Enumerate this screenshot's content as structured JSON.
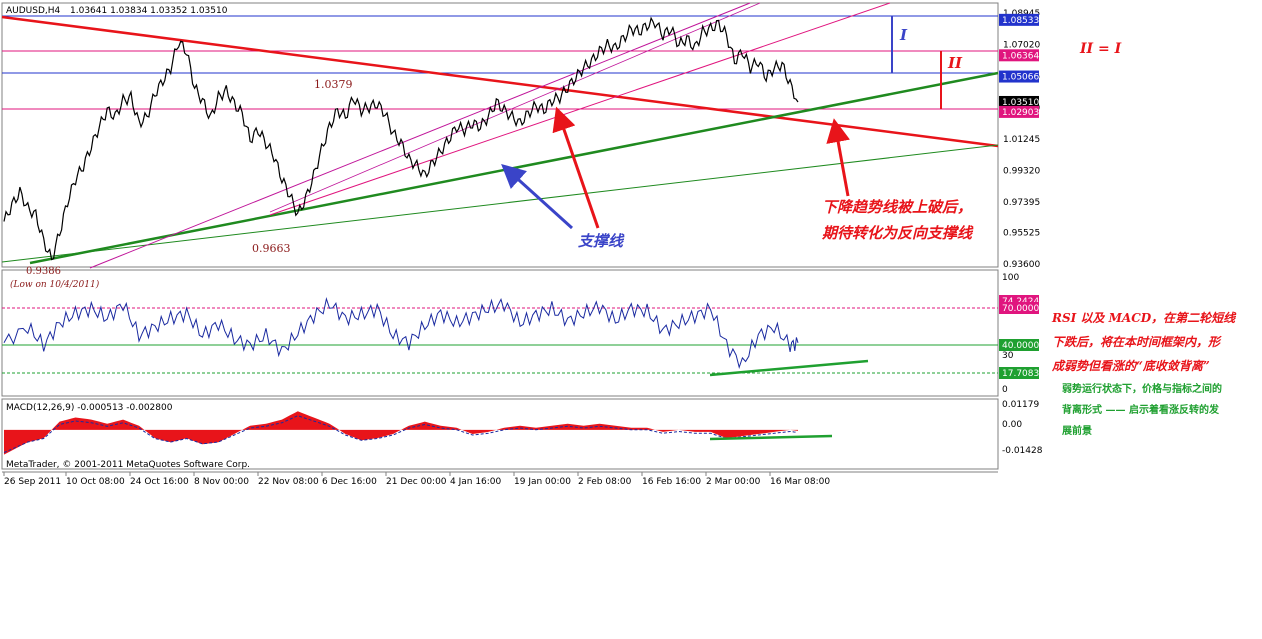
{
  "chart_data": {
    "type": "line",
    "title": "AUDUSD,H4",
    "ohlc": "1.03641 1.03834 1.03352 1.03510",
    "x_ticks": [
      "26 Sep 2011",
      "10 Oct 08:00",
      "24 Oct 16:00",
      "8 Nov 00:00",
      "22 Nov 08:00",
      "6 Dec 16:00",
      "21 Dec 00:00",
      "4 Jan 16:00",
      "19 Jan 00:00",
      "2 Feb 08:00",
      "16 Feb 16:00",
      "2 Mar 00:00",
      "16 Mar 08:00"
    ],
    "price_ticks": [
      "1.08945",
      "1.07020",
      "1.05095",
      "1.03170",
      "1.01245",
      "0.99320",
      "0.97395",
      "0.95525",
      "0.93600"
    ],
    "price_ylim": [
      0.936,
      1.0938
    ],
    "price_badges": [
      {
        "value": "1.08533",
        "color": "#2233cc"
      },
      {
        "value": "1.06364",
        "color": "#e0157e"
      },
      {
        "value": "1.05066",
        "color": "#2233cc"
      },
      {
        "value": "1.03510",
        "color": "#000000"
      },
      {
        "value": "1.02903",
        "color": "#e0157e"
      }
    ],
    "price_series": [
      [
        0,
        0.962
      ],
      [
        2,
        0.972
      ],
      [
        4,
        0.98
      ],
      [
        6,
        0.97
      ],
      [
        8,
        0.966
      ],
      [
        10,
        0.95
      ],
      [
        12,
        0.9386
      ],
      [
        14,
        0.955
      ],
      [
        16,
        0.974
      ],
      [
        18,
        0.988
      ],
      [
        20,
        0.996
      ],
      [
        22,
        1.008
      ],
      [
        24,
        1.02
      ],
      [
        26,
        1.03
      ],
      [
        28,
        1.026
      ],
      [
        30,
        1.036
      ],
      [
        32,
        1.038
      ],
      [
        34,
        1.022
      ],
      [
        36,
        1.026
      ],
      [
        38,
        1.04
      ],
      [
        40,
        1.048
      ],
      [
        42,
        1.056
      ],
      [
        44,
        1.072
      ],
      [
        46,
        1.066
      ],
      [
        48,
        1.044
      ],
      [
        50,
        1.036
      ],
      [
        52,
        1.025
      ],
      [
        54,
        1.038
      ],
      [
        56,
        1.042
      ],
      [
        58,
        1.034
      ],
      [
        60,
        1.028
      ],
      [
        62,
        1.012
      ],
      [
        64,
        1.018
      ],
      [
        66,
        1.01
      ],
      [
        68,
        1.002
      ],
      [
        70,
        0.988
      ],
      [
        72,
        0.978
      ],
      [
        74,
        0.9663
      ],
      [
        76,
        0.976
      ],
      [
        78,
        0.99
      ],
      [
        80,
        1.006
      ],
      [
        82,
        1.02
      ],
      [
        84,
        1.03
      ],
      [
        86,
        1.026
      ],
      [
        88,
        1.0379
      ],
      [
        90,
        1.03
      ],
      [
        92,
        1.032
      ],
      [
        94,
        1.034
      ],
      [
        96,
        1.028
      ],
      [
        98,
        1.016
      ],
      [
        100,
        1.01
      ],
      [
        102,
        1.0
      ],
      [
        104,
        0.996
      ],
      [
        106,
        0.99
      ],
      [
        108,
        0.998
      ],
      [
        110,
        1.005
      ],
      [
        112,
        1.012
      ],
      [
        114,
        1.02
      ],
      [
        116,
        1.018
      ],
      [
        118,
        1.022
      ],
      [
        120,
        1.02
      ],
      [
        122,
        1.026
      ],
      [
        124,
        1.035
      ],
      [
        126,
        1.03
      ],
      [
        128,
        1.026
      ],
      [
        130,
        1.022
      ],
      [
        132,
        1.028
      ],
      [
        134,
        1.033
      ],
      [
        136,
        1.03
      ],
      [
        138,
        1.036
      ],
      [
        140,
        1.038
      ],
      [
        142,
        1.044
      ],
      [
        144,
        1.05
      ],
      [
        146,
        1.056
      ],
      [
        148,
        1.06
      ],
      [
        150,
        1.066
      ],
      [
        152,
        1.07
      ],
      [
        154,
        1.068
      ],
      [
        156,
        1.074
      ],
      [
        158,
        1.08
      ],
      [
        160,
        1.078
      ],
      [
        162,
        1.082
      ],
      [
        164,
        1.084
      ],
      [
        166,
        1.076
      ],
      [
        168,
        1.08
      ],
      [
        170,
        1.07
      ],
      [
        172,
        1.074
      ],
      [
        174,
        1.068
      ],
      [
        176,
        1.078
      ],
      [
        178,
        1.08
      ],
      [
        180,
        1.083
      ],
      [
        182,
        1.076
      ],
      [
        184,
        1.06
      ],
      [
        186,
        1.066
      ],
      [
        188,
        1.056
      ],
      [
        190,
        1.06
      ],
      [
        192,
        1.05
      ],
      [
        194,
        1.056
      ],
      [
        196,
        1.058
      ],
      [
        198,
        1.046
      ],
      [
        200,
        1.0351
      ]
    ],
    "rsi_label_ticks": [
      "100",
      "30",
      "0"
    ],
    "rsi_badges": [
      {
        "value": "74.2424",
        "color": "#e0157e"
      },
      {
        "value": "70.0000",
        "color": "#e0157e"
      },
      {
        "value": "40.0000",
        "color": "#1fa030"
      },
      {
        "value": "17.7083",
        "color": "#1fa030"
      }
    ],
    "rsi_ylim": [
      0,
      100
    ],
    "rsi_series": [
      [
        0,
        42
      ],
      [
        6,
        55
      ],
      [
        10,
        40
      ],
      [
        14,
        58
      ],
      [
        18,
        66
      ],
      [
        22,
        70
      ],
      [
        26,
        62
      ],
      [
        30,
        74
      ],
      [
        34,
        48
      ],
      [
        38,
        55
      ],
      [
        42,
        62
      ],
      [
        46,
        66
      ],
      [
        50,
        48
      ],
      [
        54,
        58
      ],
      [
        58,
        45
      ],
      [
        62,
        40
      ],
      [
        66,
        48
      ],
      [
        70,
        35
      ],
      [
        74,
        50
      ],
      [
        78,
        64
      ],
      [
        82,
        74
      ],
      [
        86,
        62
      ],
      [
        90,
        65
      ],
      [
        94,
        70
      ],
      [
        98,
        48
      ],
      [
        102,
        42
      ],
      [
        106,
        56
      ],
      [
        110,
        66
      ],
      [
        114,
        58
      ],
      [
        118,
        64
      ],
      [
        122,
        70
      ],
      [
        126,
        74
      ],
      [
        130,
        58
      ],
      [
        134,
        65
      ],
      [
        138,
        70
      ],
      [
        142,
        60
      ],
      [
        146,
        66
      ],
      [
        150,
        72
      ],
      [
        154,
        60
      ],
      [
        158,
        70
      ],
      [
        162,
        68
      ],
      [
        166,
        52
      ],
      [
        170,
        58
      ],
      [
        174,
        64
      ],
      [
        178,
        70
      ],
      [
        182,
        40
      ],
      [
        186,
        24
      ],
      [
        190,
        48
      ],
      [
        194,
        55
      ],
      [
        198,
        40
      ],
      [
        200,
        42
      ]
    ],
    "macd_label": "MACD(12,26,9) -0.000513 -0.002800",
    "macd_ticks": [
      "0.01179",
      "0.00",
      "-0.01428"
    ],
    "macd_ylim": [
      -0.018,
      0.014
    ],
    "macd_series": [
      [
        0,
        -0.012
      ],
      [
        6,
        -0.006
      ],
      [
        10,
        -0.004
      ],
      [
        14,
        0.004
      ],
      [
        18,
        0.006
      ],
      [
        22,
        0.005
      ],
      [
        26,
        0.003
      ],
      [
        30,
        0.005
      ],
      [
        34,
        0.002
      ],
      [
        38,
        -0.004
      ],
      [
        42,
        -0.006
      ],
      [
        46,
        -0.004
      ],
      [
        50,
        -0.007
      ],
      [
        54,
        -0.006
      ],
      [
        58,
        -0.002
      ],
      [
        62,
        0.002
      ],
      [
        66,
        0.003
      ],
      [
        70,
        0.005
      ],
      [
        74,
        0.009
      ],
      [
        78,
        0.006
      ],
      [
        82,
        0.003
      ],
      [
        86,
        -0.002
      ],
      [
        90,
        -0.005
      ],
      [
        94,
        -0.004
      ],
      [
        98,
        -0.002
      ],
      [
        102,
        0.002
      ],
      [
        106,
        0.004
      ],
      [
        110,
        0.002
      ],
      [
        114,
        0.001
      ],
      [
        118,
        -0.002
      ],
      [
        122,
        -0.001
      ],
      [
        126,
        0.001
      ],
      [
        130,
        0.002
      ],
      [
        134,
        0.001
      ],
      [
        138,
        0.002
      ],
      [
        142,
        0.003
      ],
      [
        146,
        0.002
      ],
      [
        150,
        0.003
      ],
      [
        154,
        0.002
      ],
      [
        158,
        0.001
      ],
      [
        162,
        0.001
      ],
      [
        166,
        -0.001
      ],
      [
        170,
        0.0
      ],
      [
        174,
        -0.001
      ],
      [
        178,
        -0.001
      ],
      [
        182,
        -0.004
      ],
      [
        186,
        -0.003
      ],
      [
        190,
        -0.002
      ],
      [
        194,
        -0.001
      ],
      [
        198,
        0.0
      ],
      [
        200,
        -0.0005
      ]
    ],
    "copyright": "MetaTrader, © 2001-2011 MetaQuotes Software Corp.",
    "point_labels": {
      "high_1": "1.0379",
      "low_2": "0.9663",
      "low_1": "0.9386",
      "low_1_note": "(Low on 10/4/2011)"
    }
  },
  "annotations": {
    "support_line": "支撑线",
    "breakout_1": "下降趋势线被上破后，",
    "breakout_2": "期待转化为反向支撑线",
    "mark_i": "I",
    "mark_ii": "II",
    "equation": "II = I",
    "rsi_note_1": "RSI 以及 MACD，在第二轮短线",
    "rsi_note_2": "下跌后，将在本时间框架内，形",
    "rsi_note_3": "成弱势但看涨的“底收敛背离”",
    "div_note_1": "弱势运行状态下，价格与指标之间的",
    "div_note_2": "背离形式 —— 启示着看涨反转的发",
    "div_note_3": "展前景"
  },
  "colors": {
    "price": "#000000",
    "rsi": "#1a2aa0",
    "macd_hist": "#e8141a",
    "downtrend": "#e8141a",
    "uptrend": "#1f8a1f",
    "channel": "#c0169a",
    "arrow_red": "#e8141a",
    "arrow_blue": "#3a44c8"
  }
}
